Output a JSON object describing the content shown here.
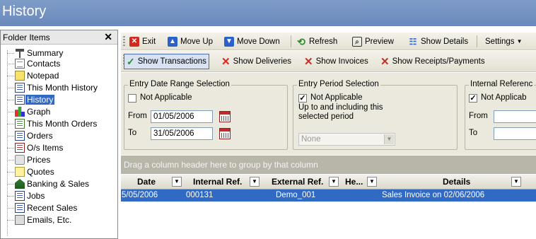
{
  "window": {
    "title": "History"
  },
  "folders": {
    "header": "Folder Items",
    "close_glyph": "✕",
    "items": [
      {
        "label": "Summary",
        "icon": "summary-icon"
      },
      {
        "label": "Contacts",
        "icon": "contacts-icon"
      },
      {
        "label": "Notepad",
        "icon": "notepad-icon"
      },
      {
        "label": "This Month History",
        "icon": "history-list-icon"
      },
      {
        "label": "History",
        "icon": "history-icon",
        "selected": true
      },
      {
        "label": "Graph",
        "icon": "graph-icon"
      },
      {
        "label": "This Month Orders",
        "icon": "orders-list-icon"
      },
      {
        "label": "Orders",
        "icon": "orders-icon"
      },
      {
        "label": "O/s Items",
        "icon": "outstanding-items-icon"
      },
      {
        "label": "Prices",
        "icon": "prices-icon"
      },
      {
        "label": "Quotes",
        "icon": "quotes-icon"
      },
      {
        "label": "Banking & Sales",
        "icon": "banking-icon"
      },
      {
        "label": "Jobs",
        "icon": "jobs-icon"
      },
      {
        "label": "Recent Sales",
        "icon": "recent-sales-icon"
      },
      {
        "label": "Emails, Etc.",
        "icon": "emails-icon"
      }
    ]
  },
  "toolbar": {
    "exit": "Exit",
    "move_up": "Move Up",
    "move_down": "Move Down",
    "refresh": "Refresh",
    "preview": "Preview",
    "show_details": "Show Details",
    "settings": "Settings"
  },
  "filter_toolbar": {
    "show_transactions": "Show Transactions",
    "show_deliveries": "Show Deliveries",
    "show_invoices": "Show Invoices",
    "show_receipts": "Show Receipts/Payments"
  },
  "entry_date": {
    "title": "Entry Date Range Selection",
    "not_applicable": "Not Applicable",
    "not_applicable_checked": false,
    "from_label": "From",
    "from_value": "01/05/2006",
    "to_label": "To",
    "to_value": "31/05/2006"
  },
  "entry_period": {
    "title": "Entry Period Selection",
    "not_applicable": "Not Applicable",
    "not_applicable_checked": true,
    "note": "Up to and including this selected period",
    "period_value": "None"
  },
  "internal_ref": {
    "title": "Internal Referenc",
    "not_applicable": "Not Applicab",
    "not_applicable_checked": true,
    "from_label": "From",
    "to_label": "To"
  },
  "grid": {
    "group_prompt": "Drag a column header here to group by that column",
    "columns": [
      "Date",
      "Internal Ref.",
      "External Ref.",
      "He...",
      "Details"
    ],
    "rows": [
      {
        "date": "5/05/2006",
        "internal_ref": "000131",
        "external_ref": "Demo_001",
        "he": "",
        "details": "Sales Invoice on 02/06/2006"
      }
    ]
  },
  "colors": {
    "title_bar": "#7391c3",
    "selection": "#316ac5",
    "group_panel": "#b8b5a9"
  }
}
